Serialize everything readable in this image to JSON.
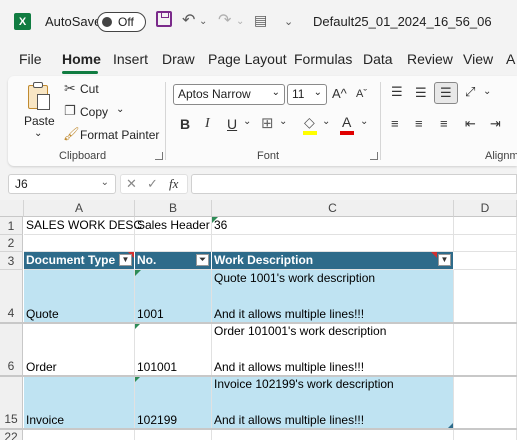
{
  "titlebar": {
    "app_icon": "X",
    "autosave_label": "AutoSave",
    "toggle_state": "Off",
    "filename": "Default25_01_2024_16_56_06",
    "icons": [
      "excel-icon",
      "save-icon",
      "undo-icon",
      "redo-icon",
      "form-icon",
      "customize-chevron-icon"
    ]
  },
  "tabs": [
    "File",
    "Home",
    "Insert",
    "Draw",
    "Page Layout",
    "Formulas",
    "Data",
    "Review",
    "View",
    "A"
  ],
  "active_tab": "Home",
  "ribbon": {
    "clipboard": {
      "paste": "Paste",
      "cut": "Cut",
      "copy": "Copy",
      "format_painter": "Format Painter",
      "label": "Clipboard"
    },
    "font": {
      "font_name": "Aptos Narrow",
      "font_size": "11",
      "bold": "B",
      "italic": "I",
      "underline": "U",
      "label": "Font",
      "highlight_color": "#ffff00",
      "font_color": "#e00000"
    },
    "alignment": {
      "label": "Alignme"
    }
  },
  "formula_bar": {
    "name_box": "J6",
    "fx": "fx",
    "formula": ""
  },
  "grid": {
    "columns": [
      "A",
      "B",
      "C",
      "D"
    ],
    "rows": [
      "1",
      "2",
      "3",
      "4",
      "6",
      "15",
      "22"
    ],
    "row1": {
      "a": "SALES WORK DESC",
      "b": "Sales Header",
      "c": "36"
    },
    "table_headers": [
      "Document Type",
      "No.",
      "Work Description"
    ],
    "table_rows": [
      {
        "row": "4",
        "type": "Quote",
        "no": "1001",
        "desc1": "Quote 1001's work description",
        "desc2": "And it allows multiple lines!!!"
      },
      {
        "row": "6",
        "type": "Order",
        "no": "101001",
        "desc1": "Order 101001's work description",
        "desc2": "And it allows multiple lines!!!"
      },
      {
        "row": "15",
        "type": "Invoice",
        "no": "102199",
        "desc1": "Invoice 102199's work description",
        "desc2": "And it allows multiple lines!!!"
      }
    ],
    "header_color": "#2e6b8a",
    "band_color": "#bfe3f2"
  }
}
